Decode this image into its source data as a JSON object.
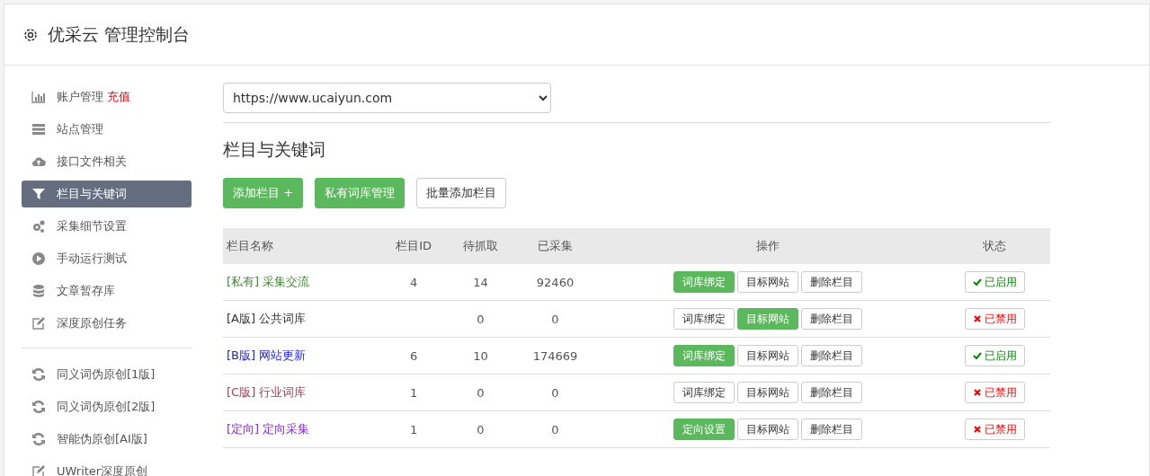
{
  "header": {
    "title": "优采云 管理控制台"
  },
  "sidebar": {
    "groups": [
      [
        {
          "label": "账户管理",
          "link": "充值",
          "selected": false
        },
        {
          "label": "站点管理",
          "selected": false
        },
        {
          "label": "接口文件相关",
          "selected": false
        },
        {
          "label": "栏目与关键词",
          "selected": true
        },
        {
          "label": "采集细节设置",
          "selected": false
        },
        {
          "label": "手动运行测试",
          "selected": false
        },
        {
          "label": "文章暂存库",
          "selected": false
        },
        {
          "label": "深度原创任务",
          "selected": false
        }
      ],
      [
        {
          "label": "同义词伪原创[1版]",
          "selected": false
        },
        {
          "label": "同义词伪原创[2版]",
          "selected": false
        },
        {
          "label": "智能伪原创[AI版]",
          "selected": false
        },
        {
          "label": "UWriter深度原创",
          "selected": false
        }
      ]
    ]
  },
  "site_select": {
    "value": "https://www.ucaiyun.com"
  },
  "section_title": "栏目与关键词",
  "toolbar": [
    {
      "label": "添加栏目 +",
      "primary": true
    },
    {
      "label": "私有词库管理",
      "primary": true
    },
    {
      "label": "批量添加栏目",
      "primary": false
    }
  ],
  "table": {
    "columns": [
      "栏目名称",
      "栏目ID",
      "待抓取",
      "已采集",
      "操作",
      "状态"
    ],
    "rows": [
      {
        "tag": "[私有]",
        "name": "采集交流",
        "color": "#3c8d2f",
        "id": "4",
        "pending": "14",
        "collected": "92460",
        "actions": [
          {
            "label": "词库绑定",
            "primary": true
          },
          {
            "label": "目标网站",
            "primary": false
          },
          {
            "label": "删除栏目",
            "primary": false
          }
        ],
        "status": "已启用",
        "enabled": true
      },
      {
        "tag": "[A版]",
        "name": "公共词库",
        "color": "#333333",
        "pending": "0",
        "collected": "0",
        "actions": [
          {
            "label": "词库绑定",
            "primary": false
          },
          {
            "label": "目标网站",
            "primary": true
          },
          {
            "label": "删除栏目",
            "primary": false
          }
        ],
        "status": "已禁用",
        "enabled": false
      },
      {
        "tag": "[B版]",
        "name": "网站更新",
        "color": "#1a1aff",
        "id": "6",
        "pending": "10",
        "collected": "174669",
        "actions": [
          {
            "label": "词库绑定",
            "primary": true
          },
          {
            "label": "目标网站",
            "primary": false
          },
          {
            "label": "删除栏目",
            "primary": false
          }
        ],
        "status": "已启用",
        "enabled": true
      },
      {
        "tag": "[C版]",
        "name": "行业词库",
        "color": "#b03a48",
        "id": "1",
        "pending": "0",
        "collected": "0",
        "actions": [
          {
            "label": "词库绑定",
            "primary": false
          },
          {
            "label": "目标网站",
            "primary": false
          },
          {
            "label": "删除栏目",
            "primary": false
          }
        ],
        "status": "已禁用",
        "enabled": false
      },
      {
        "tag": "[定向]",
        "name": "定向采集",
        "color": "#8a2be2",
        "id": "1",
        "pending": "0",
        "collected": "0",
        "actions": [
          {
            "label": "定向设置",
            "primary": true
          },
          {
            "label": "目标网站",
            "primary": false
          },
          {
            "label": "删除栏目",
            "primary": false
          }
        ],
        "status": "已禁用",
        "enabled": false
      }
    ]
  }
}
